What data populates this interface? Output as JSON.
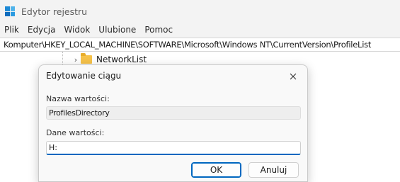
{
  "window": {
    "title": "Edytor rejestru",
    "app_icon": "registry-editor-icon"
  },
  "menu": {
    "items": [
      "Plik",
      "Edycja",
      "Widok",
      "Ulubione",
      "Pomoc"
    ]
  },
  "address": {
    "path": "Komputer\\HKEY_LOCAL_MACHINE\\SOFTWARE\\Microsoft\\Windows NT\\CurrentVersion\\ProfileList"
  },
  "tree": {
    "visible_node": {
      "label": "NetworkList",
      "icon": "folder-icon",
      "expand_icon": "chevron-right-icon"
    }
  },
  "dialog": {
    "title": "Edytowanie ciągu",
    "close_icon": "close-icon",
    "name_label": "Nazwa wartości:",
    "name_value": "ProfilesDirectory",
    "data_label": "Dane wartości:",
    "data_value": "H:",
    "ok_label": "OK",
    "cancel_label": "Anuluj",
    "accent_color": "#0067c0"
  }
}
